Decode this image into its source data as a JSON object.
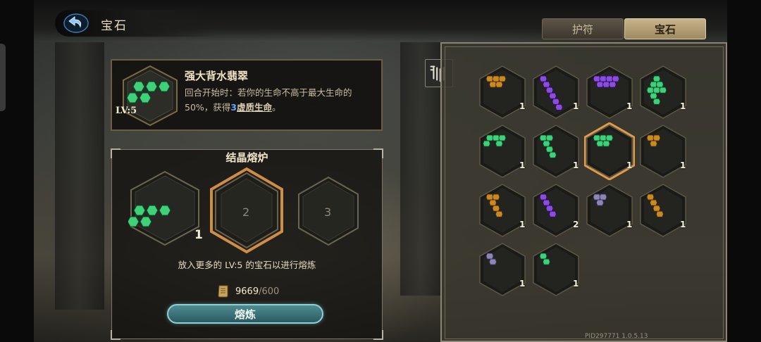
{
  "header": {
    "title": "宝石",
    "tabs": [
      {
        "label": "护符",
        "active": false
      },
      {
        "label": "宝石",
        "active": true
      }
    ]
  },
  "selected_gem": {
    "name": "强大背水翡翠",
    "level_label": "LV:5",
    "desc_prefix": "回合开始时：若你的生命不高于最大生命的50%，获得",
    "desc_value": "3",
    "desc_keyword": "虚质生命",
    "desc_suffix": "。",
    "color": "green"
  },
  "furnace": {
    "title": "结晶熔炉",
    "slots": [
      {
        "label": "",
        "count": "1",
        "filled": true,
        "color": "green"
      },
      {
        "label": "2",
        "count": "",
        "filled": false,
        "highlight": true
      },
      {
        "label": "3",
        "count": "",
        "filled": false,
        "highlight": false
      }
    ],
    "hint": "放入更多的 LV:5 的宝石以进行熔炼",
    "cost_current": "9669",
    "cost_sep": "/",
    "cost_required": "600",
    "smelt_label": "熔炼"
  },
  "inventory": {
    "gems": [
      {
        "color": "amber",
        "shape": "tri-large",
        "count": "1"
      },
      {
        "color": "purple",
        "shape": "diagonal",
        "count": "1"
      },
      {
        "color": "purple",
        "shape": "row",
        "count": "1"
      },
      {
        "color": "green",
        "shape": "cross",
        "count": "1"
      },
      {
        "color": "green",
        "shape": "row-low",
        "count": "1"
      },
      {
        "color": "green",
        "shape": "stair",
        "count": "1"
      },
      {
        "color": "green",
        "shape": "tri-large",
        "count": "1",
        "selected": true
      },
      {
        "color": "amber",
        "shape": "tri",
        "count": "1"
      },
      {
        "color": "amber",
        "shape": "stair",
        "count": "1"
      },
      {
        "color": "purple",
        "shape": "diagonal-short",
        "count": "2"
      },
      {
        "color": "lilac",
        "shape": "tri",
        "count": "1"
      },
      {
        "color": "amber",
        "shape": "diagonal-short",
        "count": "1"
      },
      {
        "color": "lilac",
        "shape": "pair",
        "count": "1"
      },
      {
        "color": "green",
        "shape": "pair",
        "count": "1"
      }
    ]
  },
  "footer": {
    "build_id": "PID297771  1.0.5.13"
  },
  "colors": {
    "accent_gold": "#c7b48c",
    "smelt_teal": "#4f8c92",
    "keyword_blue": "#5aa8ff",
    "green_gem": "#3fd07a",
    "purple_gem": "#8a4de0",
    "amber_gem": "#c98a22",
    "lilac_gem": "#8f86b8"
  },
  "icons": [
    "back-arrow-icon",
    "filter-icon",
    "scroll-icon"
  ]
}
